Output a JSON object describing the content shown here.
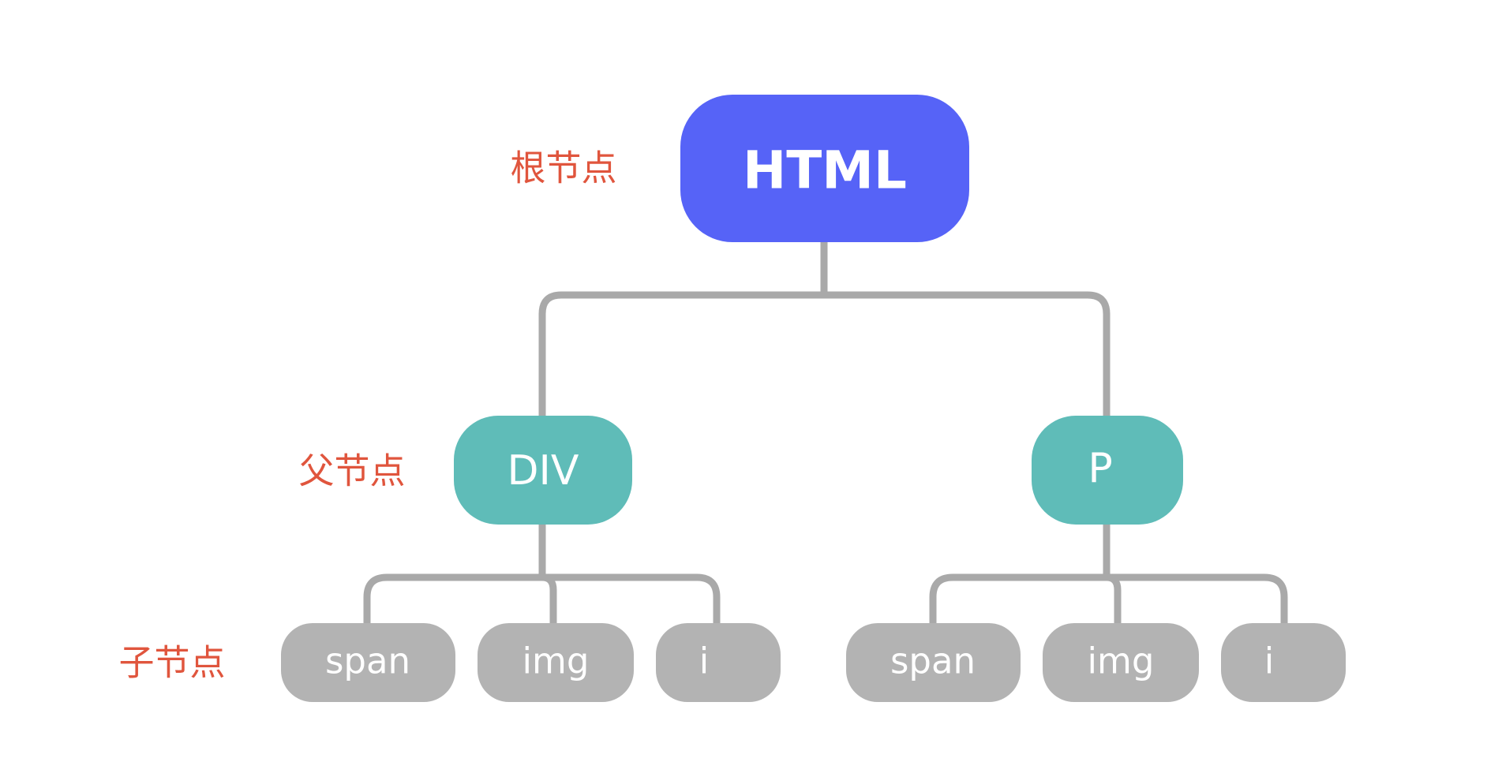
{
  "colors": {
    "root": "#5663f7",
    "parent": "#5fbcb8",
    "child": "#b3b3b3",
    "connector": "#a9a9a9",
    "level_label": "#e0553d",
    "node_text": "#ffffff"
  },
  "level_labels": {
    "root": "根节点",
    "parent": "父节点",
    "child": "子节点"
  },
  "tree": {
    "root": {
      "label": "HTML"
    },
    "parents": [
      {
        "label": "DIV",
        "children": [
          {
            "label": "span"
          },
          {
            "label": "img"
          },
          {
            "label": "i"
          }
        ]
      },
      {
        "label": "P",
        "children": [
          {
            "label": "span"
          },
          {
            "label": "img"
          },
          {
            "label": "i"
          }
        ]
      }
    ]
  }
}
